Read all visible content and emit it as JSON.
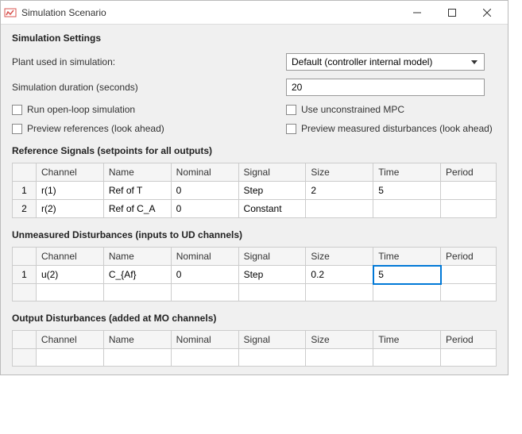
{
  "window": {
    "title": "Simulation Scenario"
  },
  "settings": {
    "heading": "Simulation Settings",
    "plant_label": "Plant used in simulation:",
    "plant_value": "Default (controller internal model)",
    "duration_label": "Simulation duration (seconds)",
    "duration_value": "20",
    "open_loop_label": "Run open-loop simulation",
    "unconstrained_label": "Use unconstrained MPC",
    "preview_ref_label": "Preview references (look ahead)",
    "preview_md_label": "Preview measured disturbances (look ahead)"
  },
  "headers": {
    "channel": "Channel",
    "name": "Name",
    "nominal": "Nominal",
    "signal": "Signal",
    "size": "Size",
    "time": "Time",
    "period": "Period"
  },
  "ref": {
    "heading": "Reference Signals (setpoints for all outputs)",
    "rows": [
      {
        "num": "1",
        "channel": "r(1)",
        "name": "Ref of T",
        "nominal": "0",
        "signal": "Step",
        "size": "2",
        "time": "5",
        "period": ""
      },
      {
        "num": "2",
        "channel": "r(2)",
        "name": "Ref of C_A",
        "nominal": "0",
        "signal": "Constant",
        "size": "",
        "time": "",
        "period": ""
      }
    ]
  },
  "ud": {
    "heading": "Unmeasured Disturbances (inputs to UD channels)",
    "rows": [
      {
        "num": "1",
        "channel": "u(2)",
        "name": "C_{Af}",
        "nominal": "0",
        "signal": "Step",
        "size": "0.2",
        "time": "5",
        "period": ""
      }
    ]
  },
  "od": {
    "heading": "Output Disturbances (added at MO channels)"
  }
}
